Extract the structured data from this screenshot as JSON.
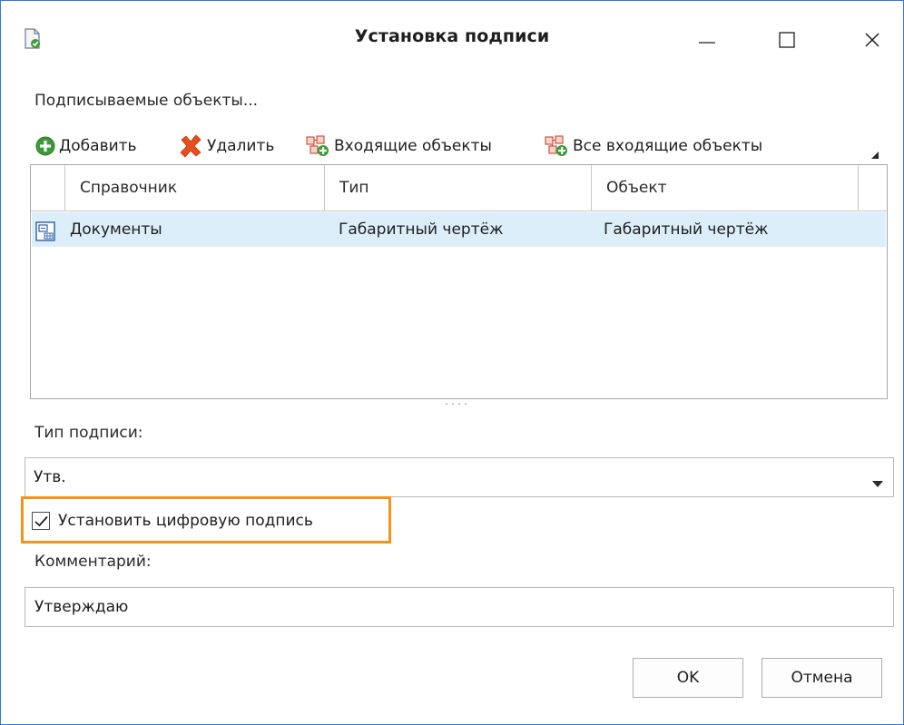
{
  "window": {
    "title": "Установка подписи"
  },
  "objects": {
    "label": "Подписываемые объекты...",
    "toolbar": {
      "add": "Добавить",
      "delete": "Удалить",
      "incoming": "Входящие объекты",
      "all_incoming": "Все входящие объекты"
    },
    "columns": [
      "Справочник",
      "Тип",
      "Объект"
    ],
    "rows": [
      {
        "icon": "document-table-icon",
        "directory": "Документы",
        "type": "Габаритный чертёж",
        "object": "Габаритный чертёж"
      }
    ]
  },
  "signature_type": {
    "label": "Тип подписи:",
    "value": "Утв."
  },
  "digital_signature": {
    "label": "Установить цифровую подпись",
    "checked": true
  },
  "comment": {
    "label": "Комментарий:",
    "value": "Утверждаю"
  },
  "buttons": {
    "ok": "OK",
    "cancel": "Отмена"
  },
  "colors": {
    "accent_border": "#2b7bd6",
    "selection": "#ddeefb",
    "highlight": "#f39417"
  }
}
